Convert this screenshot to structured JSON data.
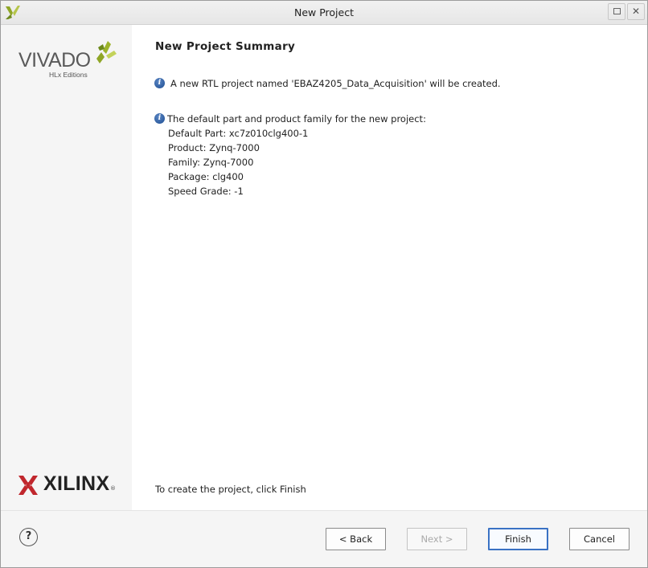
{
  "window": {
    "title": "New Project"
  },
  "sidebar": {
    "product": "VIVADO",
    "edition": "HLx Editions",
    "company": "XILINX",
    "registered": "®"
  },
  "summary": {
    "heading": "New Project Summary",
    "project_message": "A new RTL project named 'EBAZ4205_Data_Acquisition' will be created.",
    "part_intro": "The default part and product family for the new project:",
    "details": [
      "Default Part: xc7z010clg400-1",
      "Product: Zynq-7000",
      "Family: Zynq-7000",
      "Package: clg400",
      "Speed Grade: -1"
    ],
    "footer": "To create the project, click Finish"
  },
  "buttons": {
    "help": "?",
    "back": "< Back",
    "next": "Next >",
    "finish": "Finish",
    "cancel": "Cancel"
  },
  "icons": {
    "app": "vivado-app-icon",
    "info": "info-icon",
    "help": "help-icon",
    "close": "close-icon",
    "maximize": "maximize-icon"
  },
  "colors": {
    "accent": "#3a72c4",
    "info": "#1d4d91",
    "vivado_green": "#8fa626",
    "xilinx_red": "#c0272d"
  }
}
